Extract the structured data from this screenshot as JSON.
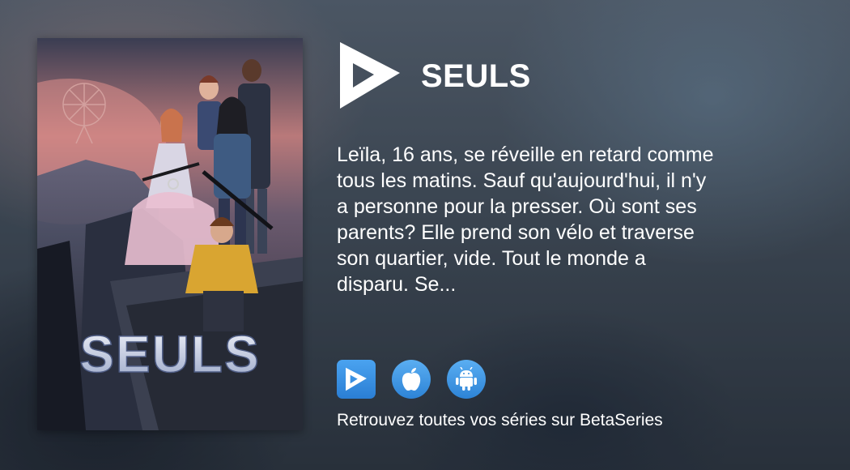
{
  "show": {
    "title": "SEULS",
    "poster_title": "SEULS",
    "synopsis_lines": [
      "Leïla, 16 ans, se réveille en retard comme",
      "tous les matins. Sauf qu'aujourd'hui, il n'y",
      "a personne pour la presser. Où sont ses",
      "parents? Elle prend son vélo et traverse",
      "son quartier, vide. Tout le monde a",
      "disparu.  Se..."
    ]
  },
  "apps": [
    {
      "name": "BetaSeries",
      "icon": "betaseries-app-icon"
    },
    {
      "name": "Apple",
      "icon": "apple-icon"
    },
    {
      "name": "Android",
      "icon": "android-icon"
    }
  ],
  "footer": {
    "text": "Retrouvez toutes vos séries sur BetaSeries"
  },
  "colors": {
    "accent": "#2f86d8",
    "text": "#ffffff"
  }
}
